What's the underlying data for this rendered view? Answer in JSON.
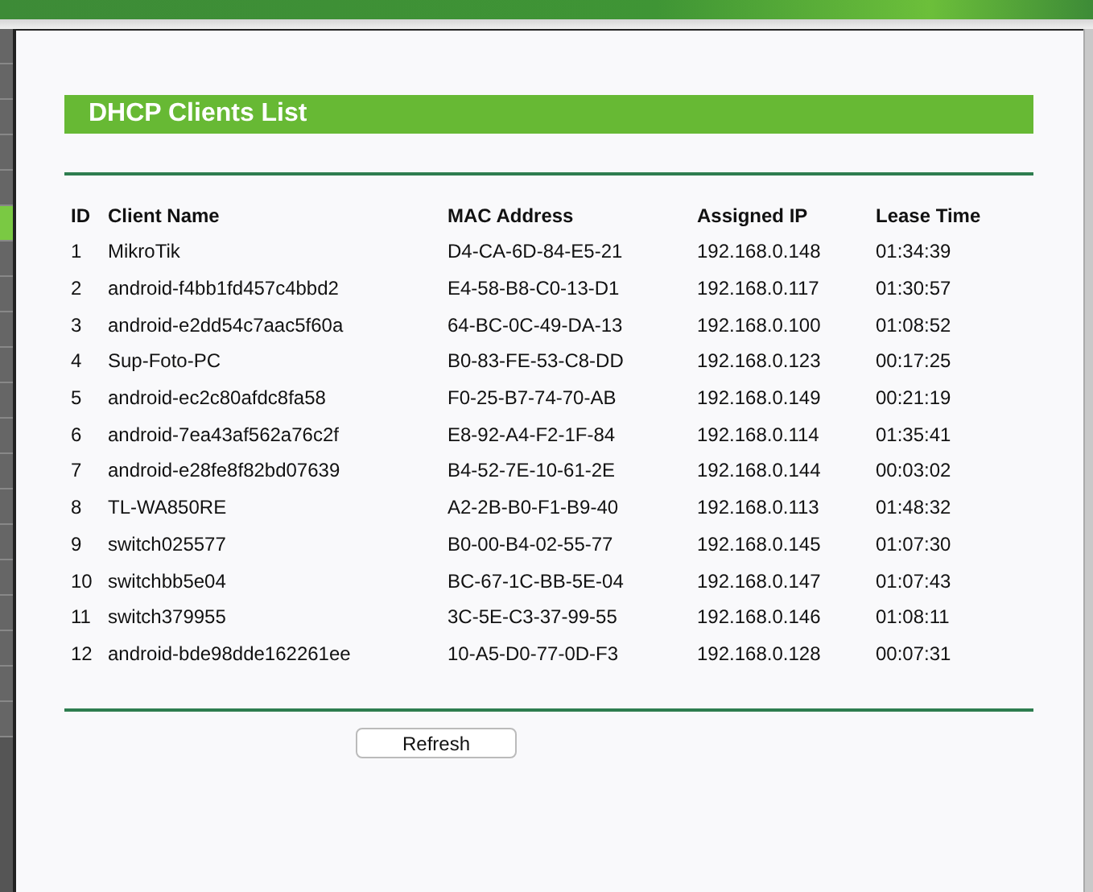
{
  "section_title": "DHCP Clients List",
  "table": {
    "columns": [
      "ID",
      "Client Name",
      "MAC Address",
      "Assigned IP",
      "Lease Time"
    ],
    "rows": [
      [
        "1",
        "MikroTik",
        "D4-CA-6D-84-E5-21",
        "192.168.0.148",
        "01:34:39"
      ],
      [
        "2",
        "android-f4bb1fd457c4bbd2",
        "E4-58-B8-C0-13-D1",
        "192.168.0.117",
        "01:30:57"
      ],
      [
        "3",
        "android-e2dd54c7aac5f60a",
        "64-BC-0C-49-DA-13",
        "192.168.0.100",
        "01:08:52"
      ],
      [
        "4",
        "Sup-Foto-PC",
        "B0-83-FE-53-C8-DD",
        "192.168.0.123",
        "00:17:25"
      ],
      [
        "5",
        "android-ec2c80afdc8fa58",
        "F0-25-B7-74-70-AB",
        "192.168.0.149",
        "00:21:19"
      ],
      [
        "6",
        "android-7ea43af562a76c2f",
        "E8-92-A4-F2-1F-84",
        "192.168.0.114",
        "01:35:41"
      ],
      [
        "7",
        "android-e28fe8f82bd07639",
        "B4-52-7E-10-61-2E",
        "192.168.0.144",
        "00:03:02"
      ],
      [
        "8",
        "TL-WA850RE",
        "A2-2B-B0-F1-B9-40",
        "192.168.0.113",
        "01:48:32"
      ],
      [
        "9",
        "switch025577",
        "B0-00-B4-02-55-77",
        "192.168.0.145",
        "01:07:30"
      ],
      [
        "10",
        "switchbb5e04",
        "BC-67-1C-BB-5E-04",
        "192.168.0.147",
        "01:07:43"
      ],
      [
        "11",
        "switch379955",
        "3C-5E-C3-37-99-55",
        "192.168.0.146",
        "01:08:11"
      ],
      [
        "12",
        "android-bde98dde162261ee",
        "10-A5-D0-77-0D-F3",
        "192.168.0.128",
        "00:07:31"
      ]
    ]
  },
  "buttons": [
    "Refresh"
  ]
}
